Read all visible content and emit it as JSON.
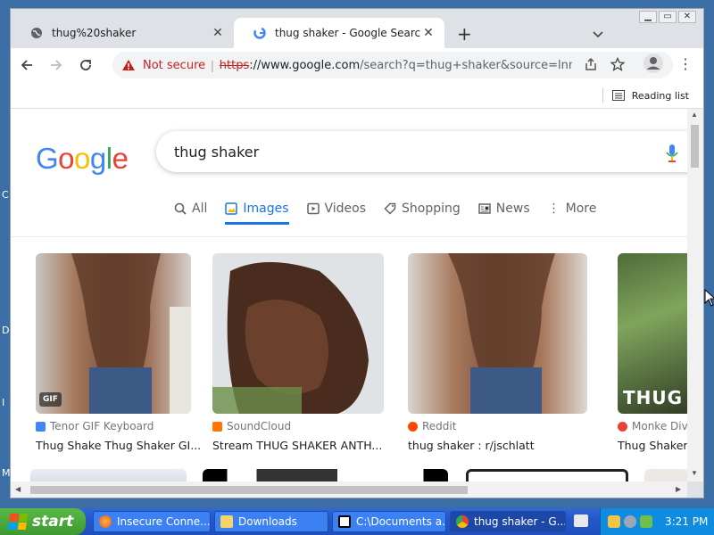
{
  "desktop": {
    "edge_letters": [
      "C",
      "D",
      "I",
      "M"
    ]
  },
  "window": {
    "controls": [
      "minimize",
      "restore",
      "close"
    ]
  },
  "tabs": [
    {
      "title": "thug%20shaker",
      "icon": "globe-icon"
    },
    {
      "title": "thug shaker - Google Search",
      "icon": "google-icon"
    }
  ],
  "address_bar": {
    "security_label": "Not secure",
    "url_scheme": "https",
    "url_host": "://www.google.com",
    "url_rest": "/search?q=thug+shaker&source=lnm..."
  },
  "bookmarks": {
    "reading_list": "Reading list"
  },
  "google": {
    "logo_letters": [
      {
        "ch": "G",
        "color": "#4285f4"
      },
      {
        "ch": "o",
        "color": "#ea4335"
      },
      {
        "ch": "o",
        "color": "#fbbc05"
      },
      {
        "ch": "g",
        "color": "#4285f4"
      },
      {
        "ch": "l",
        "color": "#34a853"
      },
      {
        "ch": "e",
        "color": "#ea4335"
      }
    ],
    "query": "thug shaker",
    "nav_tabs": [
      {
        "label": "All",
        "icon": "search-icon"
      },
      {
        "label": "Images",
        "icon": "image-icon",
        "active": true
      },
      {
        "label": "Videos",
        "icon": "video-icon"
      },
      {
        "label": "Shopping",
        "icon": "tag-icon"
      },
      {
        "label": "News",
        "icon": "news-icon"
      },
      {
        "label": "More",
        "icon": "more-icon"
      }
    ],
    "results": [
      {
        "source": "Tenor GIF Keyboard",
        "title": "Thug Shake Thug Shaker GI...",
        "badge": "GIF",
        "source_color": "#4285f4"
      },
      {
        "source": "SoundCloud",
        "title": "Stream THUG SHAKER ANTH...",
        "source_color": "#ff7700"
      },
      {
        "source": "Reddit",
        "title": "thug shaker : r/jschlatt",
        "source_color": "#ff4500"
      },
      {
        "source": "Monke Divis",
        "title": "Thug Shaker |",
        "overlay_text": "THUG",
        "source_color": "#e94235"
      }
    ]
  },
  "taskbar": {
    "start": "start",
    "tasks": [
      {
        "label": "Insecure Conne...",
        "icon": "firefox-icon"
      },
      {
        "label": "Downloads",
        "icon": "folder-icon"
      },
      {
        "label": "C:\\Documents a...",
        "icon": "7zip-icon"
      },
      {
        "label": "thug shaker - G...",
        "icon": "chrome-icon",
        "active": true
      }
    ],
    "clock": "3:21 PM"
  }
}
